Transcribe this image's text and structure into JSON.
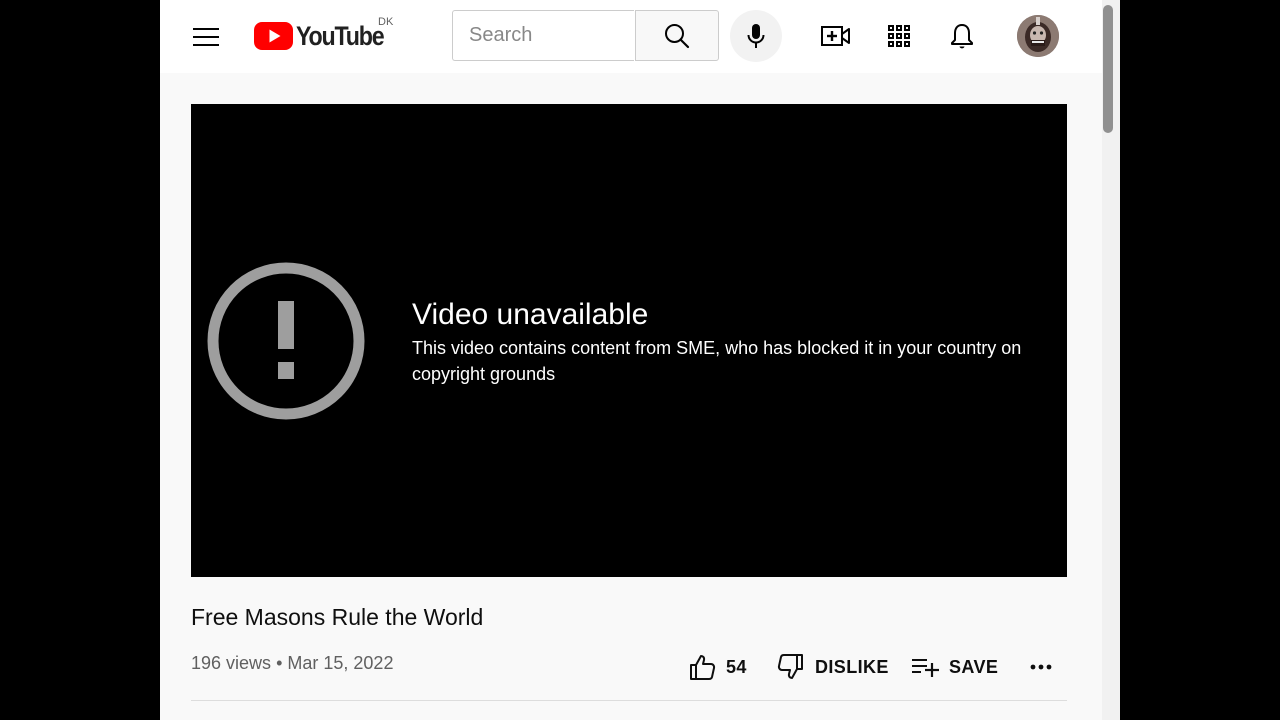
{
  "header": {
    "logo_text": "YouTube",
    "country_code": "DK",
    "search_placeholder": "Search",
    "brand_color": "#FF0000"
  },
  "player": {
    "error_title": "Video unavailable",
    "error_message": "This video contains content from SME, who has blocked it in your country on copyright grounds"
  },
  "video": {
    "title": "Free Masons Rule the World",
    "views": "196 views",
    "date": "Mar 15, 2022",
    "separator": "•"
  },
  "actions": {
    "like_count": "54",
    "dislike_label": "DISLIKE",
    "save_label": "SAVE"
  },
  "icons": {
    "menu": "hamburger-menu-icon",
    "search": "search-icon",
    "mic": "microphone-icon",
    "create": "create-video-icon",
    "apps": "apps-grid-icon",
    "notifications": "bell-icon",
    "error": "alert-circle-icon",
    "like": "thumbs-up-icon",
    "dislike": "thumbs-down-icon",
    "save": "playlist-add-icon",
    "more": "more-horizontal-icon"
  }
}
